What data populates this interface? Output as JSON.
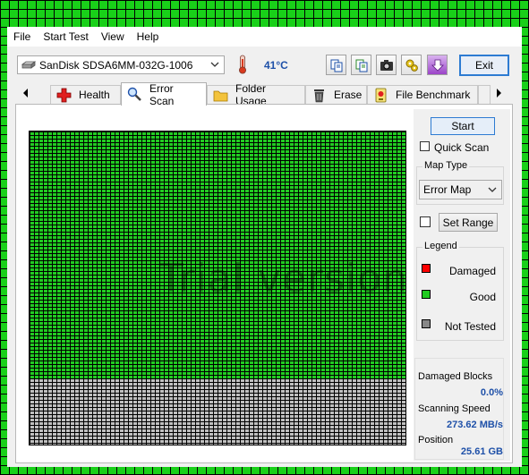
{
  "menu": [
    "File",
    "Start Test",
    "View",
    "Help"
  ],
  "toolbar": {
    "drive": "SanDisk SDSA6MM-032G-1006",
    "temperature": "41°C",
    "exit_label": "Exit"
  },
  "tabs": [
    {
      "label": "Health",
      "icon": "red-cross-icon"
    },
    {
      "label": "Error Scan",
      "icon": "magnifier-icon",
      "active": true
    },
    {
      "label": "Folder Usage",
      "icon": "folder-icon"
    },
    {
      "label": "Erase",
      "icon": "trash-icon"
    },
    {
      "label": "File Benchmark",
      "icon": "benchmark-icon"
    }
  ],
  "scan": {
    "start_label": "Start",
    "quick_scan_label": "Quick Scan",
    "map_type_title": "Map Type",
    "map_type_value": "Error Map",
    "set_range_label": "Set Range",
    "legend_title": "Legend",
    "legend": [
      {
        "label": "Damaged",
        "color": "#ff0000"
      },
      {
        "label": "Good",
        "color": "#22cc22"
      },
      {
        "label": "Not Tested",
        "color": "#888888"
      }
    ],
    "damaged_blocks_label": "Damaged Blocks",
    "damaged_blocks_value": "0.0%",
    "scanning_speed_label": "Scanning Speed",
    "scanning_speed_value": "273.62 MB/s",
    "position_label": "Position",
    "position_value": "25.61 GB",
    "progress_fraction": 0.79,
    "watermark": "Trial version"
  },
  "colors": {
    "good": "#22cc22",
    "not_tested": "#c0c0c0",
    "accent": "#2d7bd2",
    "value_text": "#1e50a8"
  }
}
